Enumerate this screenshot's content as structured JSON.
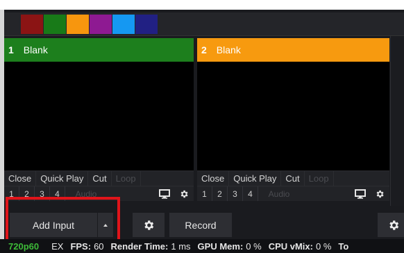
{
  "palette": {
    "colors": [
      "#8b1414",
      "#187a18",
      "#f7960e",
      "#8e1a92",
      "#1598f2",
      "#212083"
    ]
  },
  "inputs": [
    {
      "number": "1",
      "title": "Blank",
      "color": "#1d7f1d",
      "controls": [
        "Close",
        "Quick Play",
        "Cut",
        "Loop"
      ],
      "nums": [
        "1",
        "2",
        "3",
        "4"
      ],
      "audio": "Audio"
    },
    {
      "number": "2",
      "title": "Blank",
      "color": "#f79a0f",
      "controls": [
        "Close",
        "Quick Play",
        "Cut",
        "Loop"
      ],
      "nums": [
        "1",
        "2",
        "3",
        "4"
      ],
      "audio": "Audio"
    }
  ],
  "toolbar": {
    "add_input_label": "Add Input",
    "record_label": "Record"
  },
  "status": {
    "resolution": "720p60",
    "ex_label": "EX",
    "fps_label": "FPS:",
    "fps_value": "60",
    "render_label": "Render Time:",
    "render_value": "1 ms",
    "gpu_label": "GPU Mem:",
    "gpu_value": "0 %",
    "cpu_label": "CPU vMix:",
    "cpu_value": "0 %",
    "trailing": "To"
  }
}
